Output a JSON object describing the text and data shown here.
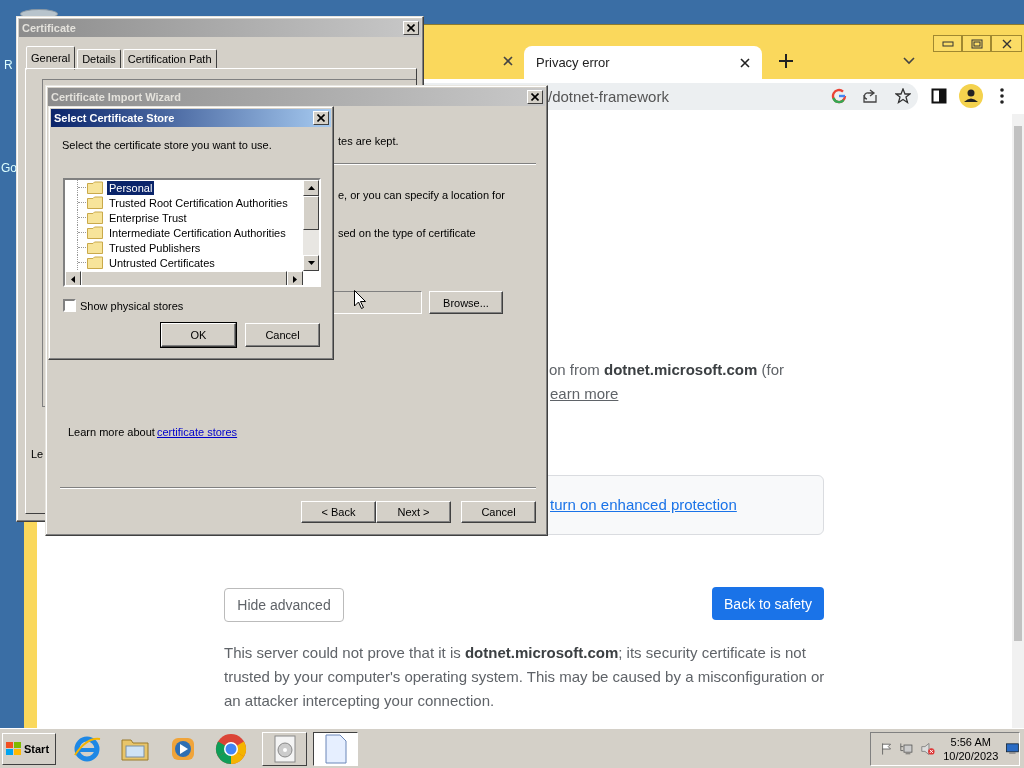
{
  "desktop": {
    "icons": [
      {
        "label": "R"
      },
      {
        "label": "Go"
      }
    ]
  },
  "browser": {
    "tabs": [
      {
        "selected": false
      },
      {
        "title": "Privacy error",
        "selected": true
      }
    ],
    "address": "/dotnet-framework",
    "page": {
      "fragment": "on from **dotnet.microsoft.com** (for",
      "learn_link": "earn more",
      "protection_link": "turn on enhanced protection",
      "hide_button": "Hide advanced",
      "safety_button": "Back to safety",
      "details": "This server could not prove that it is **dotnet.microsoft.com**; its security certificate is not trusted by your computer's operating system. This may be caused by a misconfiguration or an attacker intercepting your connection."
    }
  },
  "certificate_window": {
    "title": "Certificate",
    "active": false,
    "tabs": [
      {
        "label": "General",
        "selected": true
      },
      {
        "label": "Details",
        "selected": false
      },
      {
        "label": "Certification Path",
        "selected": false
      }
    ],
    "fragment": "Le"
  },
  "wizard": {
    "title": "Certificate Import Wizard",
    "active": false,
    "fragments": [
      "tes are kept.",
      "e, or you can specify a location for",
      "sed on the type of certificate"
    ],
    "browse_button": "Browse...",
    "learn_more": "Learn more about",
    "learn_link": "certificate stores",
    "buttons": [
      {
        "label": "< Back"
      },
      {
        "label": "Next >"
      },
      {
        "label": "Cancel"
      }
    ]
  },
  "store_dialog": {
    "title": "Select Certificate Store",
    "active": true,
    "prompt": "Select the certificate store you want to use.",
    "stores": [
      {
        "name": "Personal",
        "selected": true
      },
      {
        "name": "Trusted Root Certification Authorities",
        "selected": false
      },
      {
        "name": "Enterprise Trust",
        "selected": false
      },
      {
        "name": "Intermediate Certification Authorities",
        "selected": false
      },
      {
        "name": "Trusted Publishers",
        "selected": false
      },
      {
        "name": "Untrusted Certificates",
        "selected": false
      }
    ],
    "show_physical": {
      "label": "Show physical stores",
      "checked": false
    },
    "buttons": [
      {
        "label": "OK",
        "default": true
      },
      {
        "label": "Cancel",
        "default": false
      }
    ]
  },
  "taskbar": {
    "start": "Start",
    "quick_launch": [
      {
        "kind": "ie"
      },
      {
        "kind": "folder"
      },
      {
        "kind": "media"
      },
      {
        "kind": "chrome"
      }
    ],
    "tasks": [
      {
        "kind": "disc",
        "pressed": false
      },
      {
        "kind": "document",
        "pressed": true
      }
    ],
    "clock": {
      "time": "5:56 AM",
      "date": "10/20/2023"
    }
  }
}
